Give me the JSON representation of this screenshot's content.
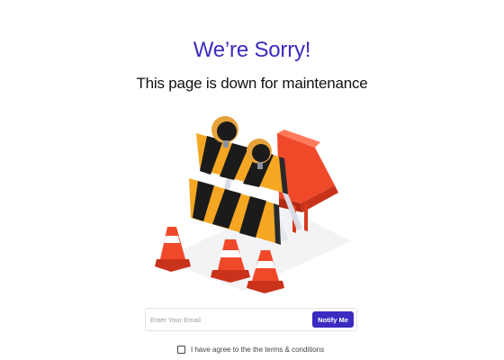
{
  "maintenance": {
    "headline": "We’re Sorry!",
    "subheadline": "This page is down for maintenance"
  },
  "colors": {
    "accent": "#3b2bc0",
    "cone_orange": "#f0492a",
    "barrier_orange": "#f5a623",
    "barrier_black": "#1b1b1b",
    "lamp_yellow": "#f5b640"
  },
  "subscribe": {
    "email_placeholder": "Enter Your Email",
    "notify_label": "Notify Me"
  },
  "terms": {
    "label": "I have agree to the the terms & conditions"
  }
}
